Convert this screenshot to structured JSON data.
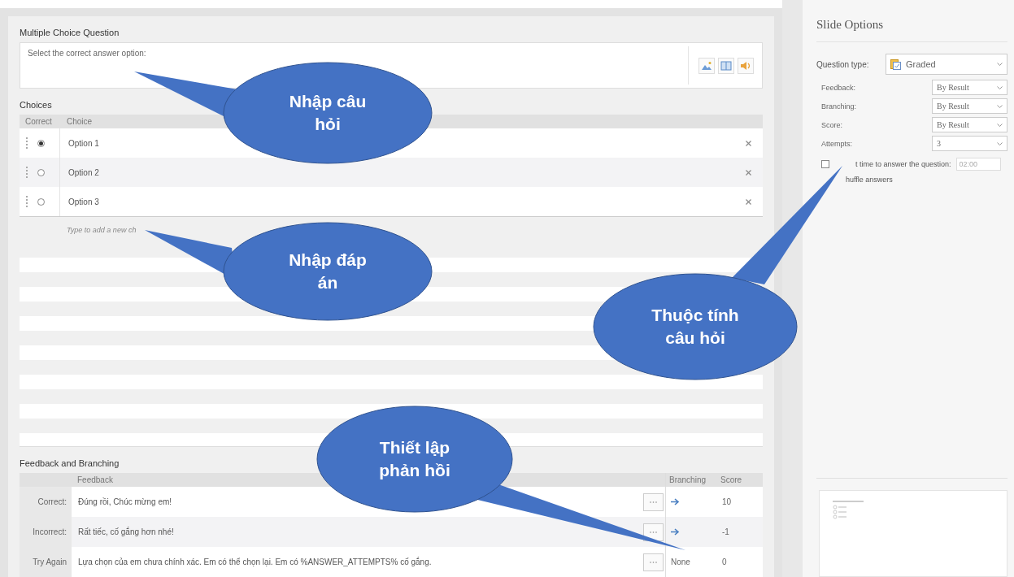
{
  "question": {
    "heading": "Multiple Choice Question",
    "text": "Select the correct answer option:"
  },
  "choices": {
    "heading": "Choices",
    "columns": [
      "Correct",
      "Choice"
    ],
    "rows": [
      {
        "text": "Option 1",
        "selected": true
      },
      {
        "text": "Option 2",
        "selected": false
      },
      {
        "text": "Option 3",
        "selected": false
      }
    ],
    "new_choice_placeholder": "Type to add a new ch"
  },
  "feedback": {
    "heading": "Feedback and Branching",
    "columns": [
      "Feedback",
      "Branching",
      "Score"
    ],
    "rows": [
      {
        "label": "Correct:",
        "text": "Đúng rồi, Chúc mừng em!",
        "branching": {
          "kind": "arrow"
        },
        "score": "10"
      },
      {
        "label": "Incorrect:",
        "text": "Rất tiếc, cố gắng hơn nhé!",
        "branching": {
          "kind": "arrow"
        },
        "score": "-1"
      },
      {
        "label": "Try Again",
        "text": "Lựa chọn của em chưa chính xác. Em có thể chọn lại. Em có  %ANSWER_ATTEMPTS% cố gắng.",
        "branching": {
          "kind": "text",
          "text": "None"
        },
        "score": "0"
      }
    ]
  },
  "slide_options": {
    "title": "Slide Options",
    "question_type": {
      "label": "Question type:",
      "value": "Graded"
    },
    "settings": [
      {
        "label": "Feedback:",
        "value": "By Result"
      },
      {
        "label": "Branching:",
        "value": "By Result"
      },
      {
        "label": "Score:",
        "value": "By Result"
      },
      {
        "label": "Attempts:",
        "value": "3"
      }
    ],
    "limit_time": {
      "checked": false,
      "label": "t time to answer the question:",
      "placeholder": "02:00"
    },
    "shuffle": {
      "label": "huffle answers"
    }
  },
  "callouts": [
    {
      "text": "Nhập câu hỏi"
    },
    {
      "text": "Nhập đáp án"
    },
    {
      "text": "Thuộc tính câu hỏi"
    },
    {
      "text": "Thiết lập phản hồi"
    }
  ]
}
